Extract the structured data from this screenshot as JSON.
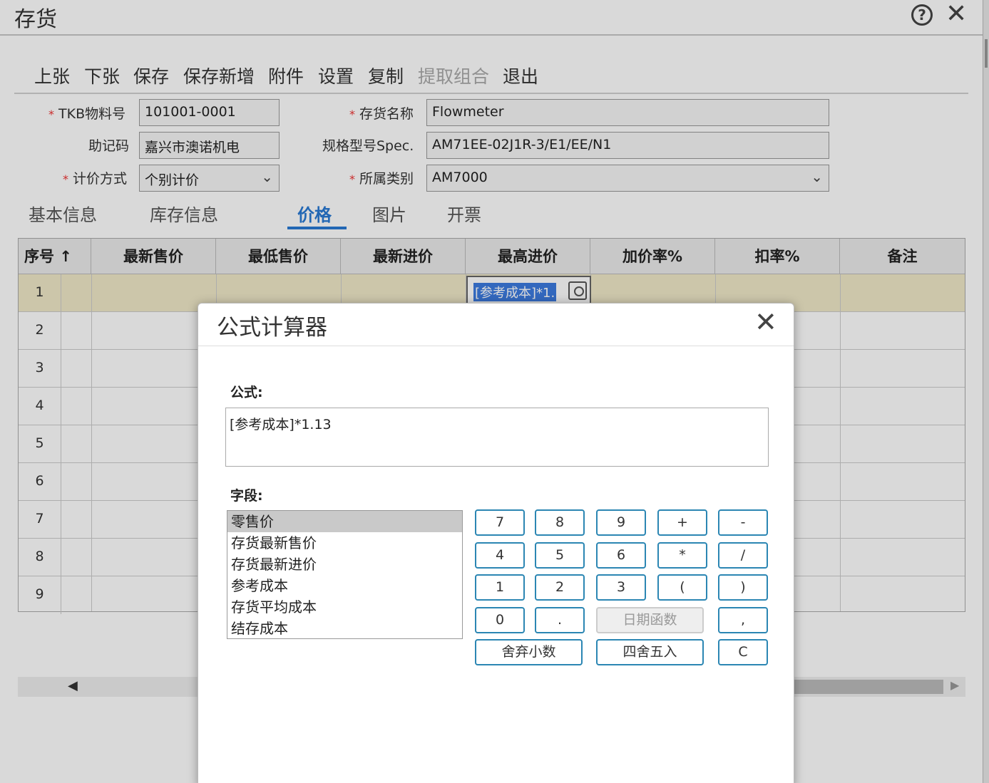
{
  "window": {
    "title": "存货"
  },
  "toolbar": {
    "items": [
      "上张",
      "下张",
      "保存",
      "保存新增",
      "附件",
      "设置",
      "复制",
      "提取组合",
      "退出"
    ]
  },
  "form": {
    "tkb_label": "TKB物料号",
    "tkb_value": "101001-0001",
    "name_label": "存货名称",
    "name_value": "Flowmeter",
    "mnemonic_label": "助记码",
    "mnemonic_value": "嘉兴市澳诺机电",
    "spec_label": "规格型号Spec.",
    "spec_value": "AM71EE-02J1R-3/E1/EE/N1",
    "pricing_label": "计价方式",
    "pricing_value": "个别计价",
    "category_label": "所属类别",
    "category_value": "AM7000",
    "required_mark": "*"
  },
  "tabs": [
    "基本信息",
    "库存信息",
    "价格",
    "图片",
    "开票"
  ],
  "grid": {
    "headers": [
      "序号",
      "最新售价",
      "最低售价",
      "最新进价",
      "最高进价",
      "加价率%",
      "扣率%",
      "备注"
    ],
    "sort_marker": "↑",
    "rows": [
      "1",
      "2",
      "3",
      "4",
      "5",
      "6",
      "7",
      "8",
      "9"
    ],
    "editing_text": "[参考成本]*1."
  },
  "dialog": {
    "title": "公式计算器",
    "formula_label": "公式:",
    "formula_value": "[参考成本]*1.13",
    "fields_label": "字段:",
    "fields": [
      "零售价",
      "存货最新售价",
      "存货最新进价",
      "参考成本",
      "存货平均成本",
      "结存成本"
    ],
    "keys": {
      "k7": "7",
      "k8": "8",
      "k9": "9",
      "plus": "+",
      "minus": "-",
      "k4": "4",
      "k5": "5",
      "k6": "6",
      "mul": "*",
      "div": "/",
      "k1": "1",
      "k2": "2",
      "k3": "3",
      "lparen": "(",
      "rparen": ")",
      "k0": "0",
      "dot": ".",
      "date_fn": "日期函数",
      "comma": ",",
      "truncate": "舍弃小数",
      "round": "四舍五入",
      "clear": "C"
    }
  }
}
